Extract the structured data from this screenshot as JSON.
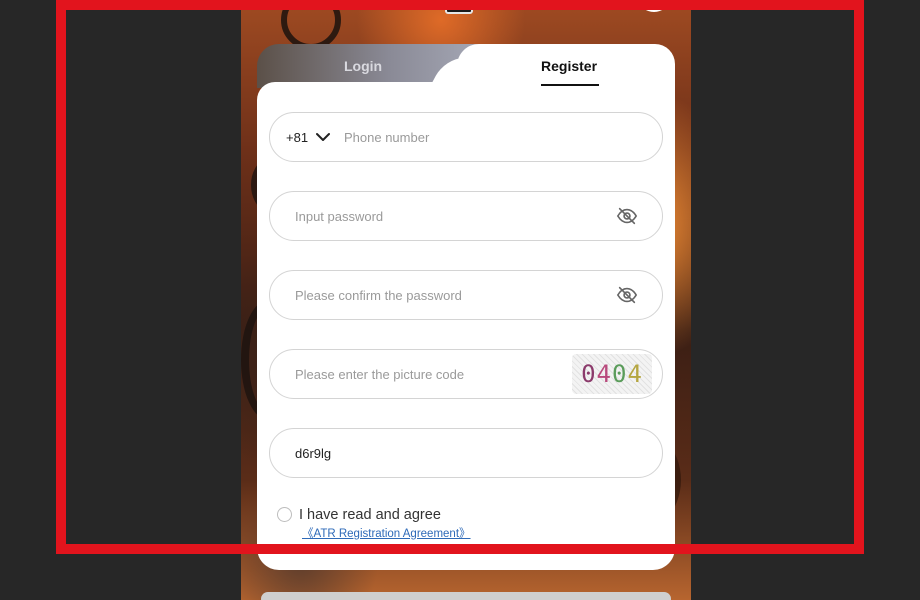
{
  "tabs": {
    "login": "Login",
    "register": "Register"
  },
  "form": {
    "phone": {
      "country_code": "+81",
      "placeholder": "Phone number",
      "value": ""
    },
    "password": {
      "placeholder": "Input password",
      "value": ""
    },
    "confirm_password": {
      "placeholder": "Please confirm the password",
      "value": ""
    },
    "picture_code": {
      "placeholder": "Please enter the picture code",
      "value": "",
      "captcha": [
        "0",
        "4",
        "0",
        "4"
      ]
    },
    "invite_code": {
      "placeholder": "",
      "value": "d6r9lg"
    }
  },
  "agreement": {
    "label": "I have read and agree",
    "link": "《ATR Registration Agreement》"
  },
  "icons": {
    "dropdown": "chevron-down-icon",
    "password_toggle": "eye-off-icon",
    "confirm_toggle": "eye-off-icon"
  },
  "colors": {
    "highlight": "#e2141d",
    "link": "#2e6ab8",
    "active_tab": "#111111"
  }
}
